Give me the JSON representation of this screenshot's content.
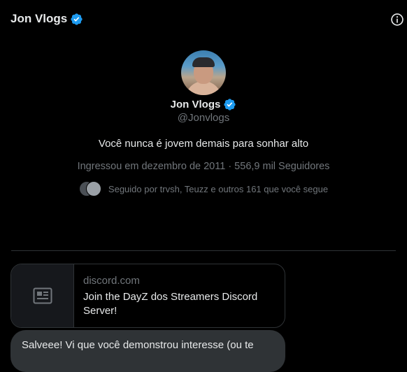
{
  "header": {
    "title": "Jon Vlogs",
    "verified_icon": "verified-badge-icon",
    "info_icon": "info-icon"
  },
  "profile": {
    "name": "Jon Vlogs",
    "handle": "@Jonvlogs",
    "bio": "Você nunca é jovem demais para sonhar alto",
    "meta": "Ingressou em dezembro de 2011 · 556,9 mil Seguidores",
    "followed_by": "Seguido por trvsh, Teuzz e outros 161 que você segue"
  },
  "link_card": {
    "domain": "discord.com",
    "title": "Join the DayZ dos Streamers Discord Server!",
    "icon": "article-icon"
  },
  "message": {
    "text": "Salveee! Vi que você demonstrou interesse (ou te"
  },
  "colors": {
    "background": "#000000",
    "text": "#e7e9ea",
    "muted": "#71767b",
    "verified": "#1d9bf0",
    "border": "#2f3336",
    "bubble": "#2f3336"
  }
}
